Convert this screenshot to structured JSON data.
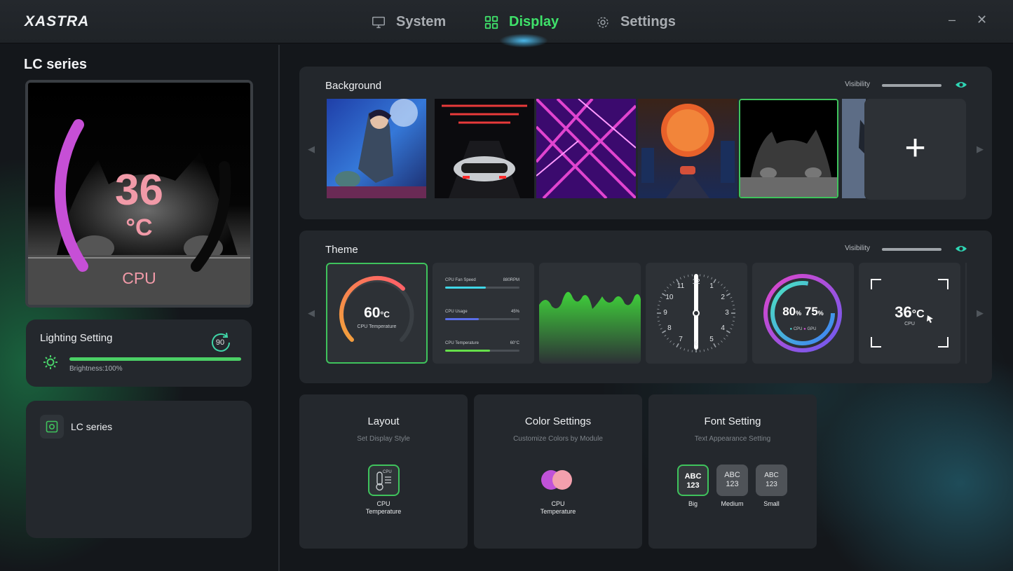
{
  "app": {
    "logo": "XASTRA"
  },
  "tabs": [
    {
      "label": "System",
      "icon": "monitor-icon",
      "active": false
    },
    {
      "label": "Display",
      "icon": "grid-icon",
      "active": true
    },
    {
      "label": "Settings",
      "icon": "gear-icon",
      "active": false
    }
  ],
  "window": {
    "minimize": "–",
    "close": "✕"
  },
  "sidebar": {
    "title": "LC series",
    "preview": {
      "temperature": "36",
      "unit": "°C",
      "label": "CPU",
      "accent": "#f19aa8",
      "arc_color": "#c64fd6"
    },
    "lighting": {
      "title": "Lighting Setting",
      "rotation": "90",
      "brightness_text": "Brightness:100%",
      "brightness": 1.0
    },
    "device": {
      "name": "LC series"
    }
  },
  "background": {
    "title": "Background",
    "visibility_label": "Visibility",
    "thumbnails": [
      "anime-character",
      "sports-car-tunnel",
      "neon-laser",
      "city-moon",
      "kitten",
      "partial"
    ],
    "selected_index": 4,
    "add_label": "+"
  },
  "theme": {
    "title": "Theme",
    "visibility_label": "Visibility",
    "gauge": {
      "value": "60",
      "unit": "°C",
      "label": "CPU Temperature",
      "fraction": 0.6
    },
    "bars": [
      {
        "label": "CPU Fan Speed",
        "value": "880RPM",
        "fraction": 0.55,
        "color": "#3fd7e8"
      },
      {
        "label": "CPU Usage",
        "value": "45%",
        "fraction": 0.45,
        "color": "#5a6ee8"
      },
      {
        "label": "CPU Temperature",
        "value": "60°C",
        "fraction": 0.6,
        "color": "#66e04a"
      }
    ],
    "clock": {
      "numbers": [
        "12",
        "1",
        "2",
        "3",
        "4",
        "5",
        "6",
        "7",
        "8",
        "9",
        "10",
        "11"
      ]
    },
    "rings": {
      "cpu_value": "80",
      "gpu_value": "75",
      "unit": "%",
      "cpu_label": "CPU",
      "gpu_label": "GPU"
    },
    "frame": {
      "value": "36",
      "unit": "°C",
      "label": "CPU"
    }
  },
  "settings": {
    "layout": {
      "title": "Layout",
      "subtitle": "Set Display Style",
      "option_line1": "CPU",
      "option_line2": "Temperature",
      "icon_text": "CPU"
    },
    "color": {
      "title": "Color Settings",
      "subtitle": "Customize Colors by Module",
      "option_line1": "CPU",
      "option_line2": "Temperature",
      "colors": [
        "#c052d8",
        "#f3a0ad"
      ]
    },
    "font": {
      "title": "Font Setting",
      "subtitle": "Text Appearance Setting",
      "options": [
        {
          "line1": "ABC",
          "line2": "123",
          "label": "Big",
          "selected": true
        },
        {
          "line1": "ABC",
          "line2": "123",
          "label": "Medium",
          "selected": false
        },
        {
          "line1": "ABC",
          "line2": "123",
          "label": "Small",
          "selected": false
        }
      ]
    }
  }
}
